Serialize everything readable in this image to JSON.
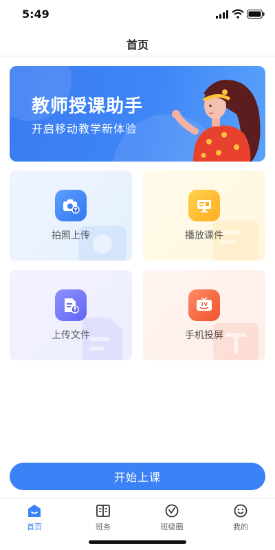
{
  "status_bar": {
    "time": "5:49"
  },
  "nav": {
    "title": "首页"
  },
  "banner": {
    "title": "教师授课助手",
    "subtitle": "开启移动教学新体验"
  },
  "tiles": [
    {
      "label": "拍照上传",
      "icon": "camera-upload-icon",
      "color": "#3b82f6"
    },
    {
      "label": "播放课件",
      "icon": "courseware-play-icon",
      "color": "#ffb020"
    },
    {
      "label": "上传文件",
      "icon": "file-upload-icon",
      "color": "#6b6ff2"
    },
    {
      "label": "手机投屏",
      "icon": "tv-cast-icon",
      "color": "#f2582f"
    }
  ],
  "start_button": {
    "label": "开始上课"
  },
  "tab_bar": {
    "active_index": 0,
    "items": [
      {
        "label": "首页",
        "icon": "home-icon"
      },
      {
        "label": "班务",
        "icon": "book-icon"
      },
      {
        "label": "班级圈",
        "icon": "circle-check-icon"
      },
      {
        "label": "我的",
        "icon": "smiley-icon"
      }
    ]
  },
  "colors": {
    "accent": "#3b82f6",
    "banner": "#3f86f6",
    "text": "#222222"
  }
}
